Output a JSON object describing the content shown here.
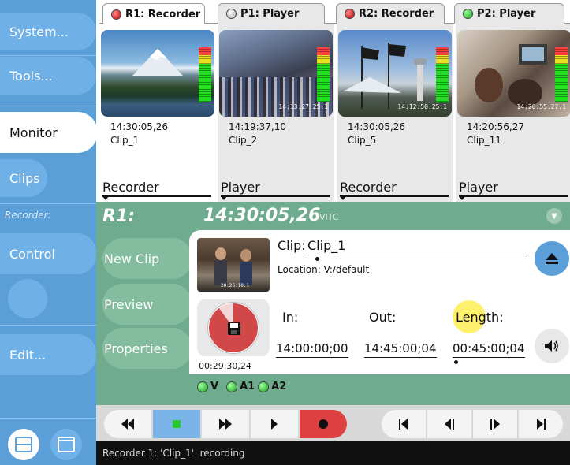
{
  "sidebar": {
    "system": "System...",
    "tools": "Tools...",
    "monitor": "Monitor",
    "clips": "Clips",
    "recorder_label": "Recorder:",
    "control": "Control",
    "edit": "Edit..."
  },
  "tabs": [
    {
      "label": "R1: Recorder",
      "status": "red"
    },
    {
      "label": "P1: Player",
      "status": "grey"
    },
    {
      "label": "R2: Recorder",
      "status": "red"
    },
    {
      "label": "P2: Player",
      "status": "green"
    }
  ],
  "monitors": [
    {
      "timecode": "14:30:05,26",
      "clip": "Clip_1",
      "mode": "Recorder",
      "overlay": ""
    },
    {
      "timecode": "14:19:37,10",
      "clip": "Clip_2",
      "mode": "Player",
      "overlay": "14:13:27.25.1"
    },
    {
      "timecode": "14:30:05,26",
      "clip": "Clip_5",
      "mode": "Recorder",
      "overlay": "14:12:50.25.1"
    },
    {
      "timecode": "14:20:56,27",
      "clip": "Clip_11",
      "mode": "Player",
      "overlay": "14:20:55.27.1"
    }
  ],
  "panel": {
    "title": "R1:",
    "timecode": "14:30:05,26",
    "tc_source": "VITC",
    "buttons": {
      "new_clip": "New Clip",
      "preview": "Preview",
      "properties": "Properties"
    },
    "clip_label": "Clip:",
    "clip_name": "Clip_1",
    "location": "Location: V:/default",
    "clip_thumb_overlay": "20:26:10.1",
    "dial_time": "00:29:30,24",
    "in_label": "In:",
    "out_label": "Out:",
    "length_label": "Length:",
    "in_value": "14:00:00;00",
    "out_value": "14:45:00;04",
    "length_value": "00:45:00;04",
    "recorded_fraction": 0.9,
    "indicators": [
      {
        "label": "V",
        "state": "green"
      },
      {
        "label": "A1",
        "state": "green"
      },
      {
        "label": "A2",
        "state": "green"
      }
    ]
  },
  "status": {
    "text": "Recorder 1: 'Clip_1'  recording"
  },
  "colors": {
    "sidebar": "#5a9fd8",
    "panel": "#6fab8e",
    "record": "#dc4040",
    "stop": "#7ab4e8",
    "highlight": "#fff06e"
  }
}
